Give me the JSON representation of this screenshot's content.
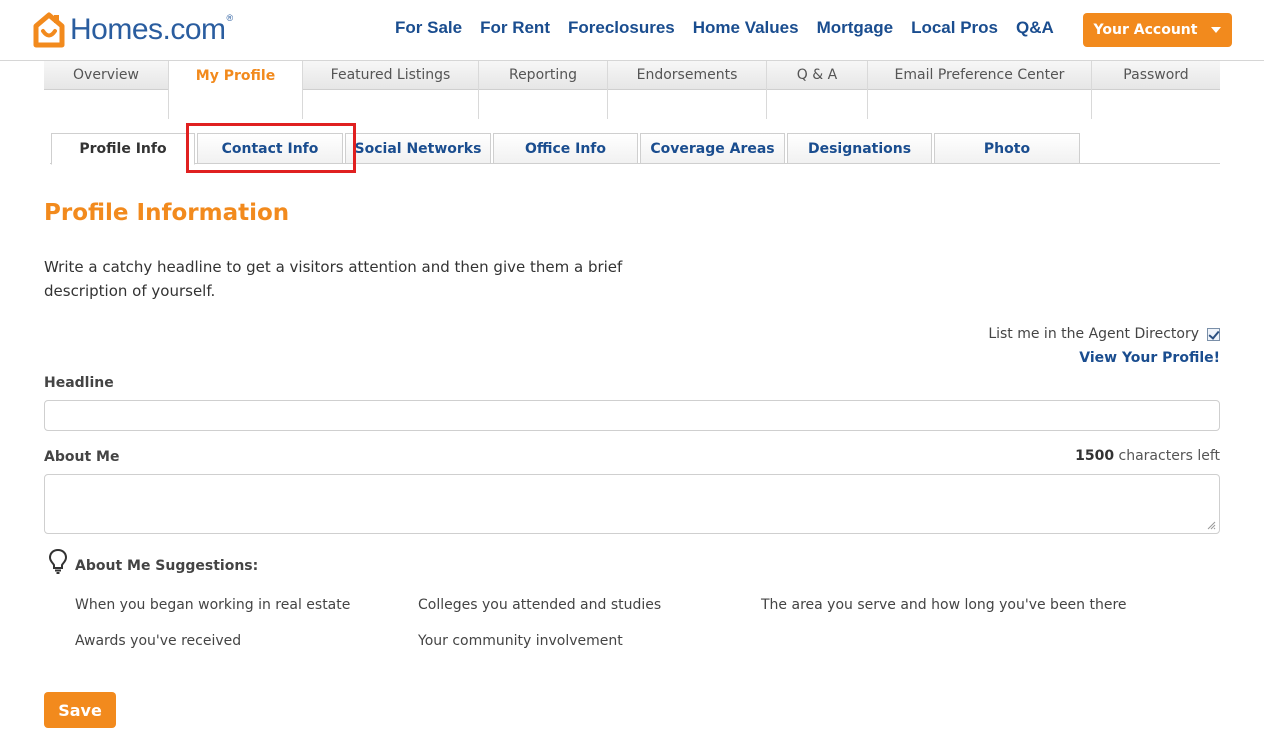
{
  "brand": {
    "name": "Homes.com",
    "name_main": "Homes",
    "name_suffix": ".com",
    "trademark": "®",
    "accent_color": "#f28a1d",
    "link_color": "#1a4d8f"
  },
  "main_nav": [
    "For Sale",
    "For Rent",
    "Foreclosures",
    "Home Values",
    "Mortgage",
    "Local Pros",
    "Q&A"
  ],
  "account_button": {
    "label": "Your Account",
    "icon": "caret-down-icon"
  },
  "primary_tabs": [
    {
      "label": "Overview",
      "active": false
    },
    {
      "label": "My Profile",
      "active": true
    },
    {
      "label": "Featured Listings",
      "active": false
    },
    {
      "label": "Reporting",
      "active": false
    },
    {
      "label": "Endorsements",
      "active": false
    },
    {
      "label": "Q & A",
      "active": false
    },
    {
      "label": "Email Preference Center",
      "active": false
    },
    {
      "label": "Password",
      "active": false
    }
  ],
  "sub_tabs": [
    {
      "label": "Profile Info",
      "active": true
    },
    {
      "label": "Contact Info",
      "active": false,
      "highlighted": true
    },
    {
      "label": "Social Networks",
      "active": false
    },
    {
      "label": "Office Info",
      "active": false
    },
    {
      "label": "Coverage Areas",
      "active": false
    },
    {
      "label": "Designations",
      "active": false
    },
    {
      "label": "Photo",
      "active": false
    }
  ],
  "profile": {
    "title": "Profile Information",
    "intro": "Write a catchy headline to get a visitors attention and then give them a brief description of yourself.",
    "directory_label": "List me in the Agent Directory",
    "directory_checked": true,
    "view_profile_link": "View Your Profile!",
    "headline_label": "Headline",
    "headline_value": "",
    "about_label": "About Me",
    "about_value": "",
    "chars_left_count": "1500",
    "chars_left_text": "characters left",
    "suggestions_title": "About Me Suggestions:",
    "suggestions_icon": "lightbulb-icon",
    "suggestions": [
      "When you began working in real estate",
      "Colleges you attended and studies",
      "The area you serve and how long you've been there",
      "Awards you've received",
      "Your community involvement"
    ],
    "save_label": "Save"
  }
}
